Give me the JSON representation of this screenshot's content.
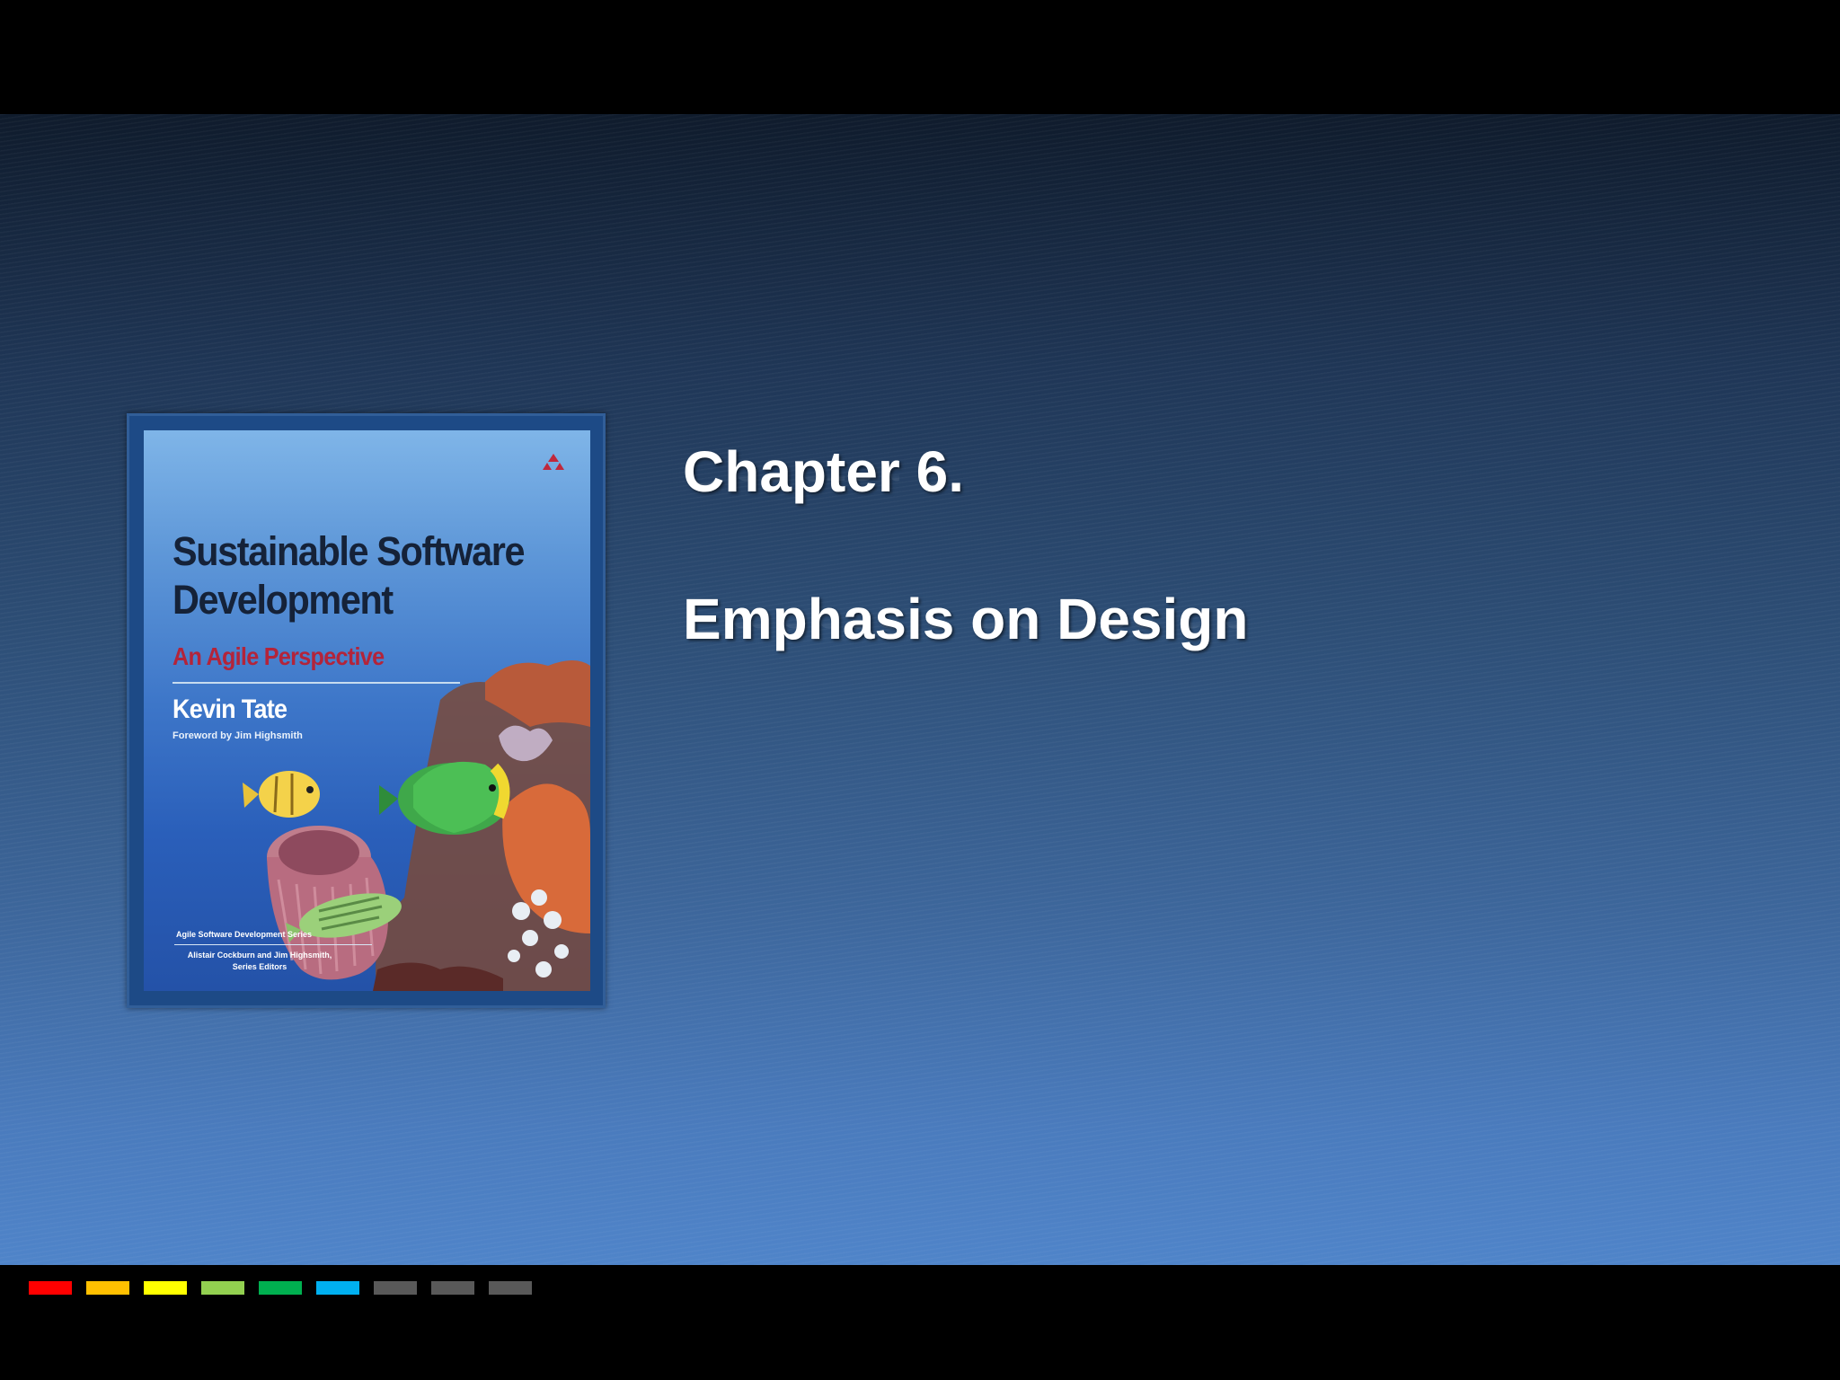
{
  "slide": {
    "heading_line1": "Chapter 6.",
    "heading_line2": "Emphasis on Design"
  },
  "book_cover": {
    "title": "Sustainable Software Development",
    "subtitle": "An Agile Perspective",
    "author": "Kevin Tate",
    "foreword": "Foreword by Jim Highsmith",
    "series": "Agile Software Development Series",
    "series_editors": "Alistair Cockburn and Jim Highsmith, Series Editors",
    "publisher_logo": "publisher-logo-icon"
  },
  "footer": {
    "swatches": [
      "#ff0000",
      "#ffc000",
      "#ffff00",
      "#92d050",
      "#00b050",
      "#00b0f0",
      "#595959",
      "#595959",
      "#595959"
    ]
  },
  "colors": {
    "background_top": "#0f1b2c",
    "background_bottom": "#4f84c9",
    "heading_text": "#ffffff",
    "cover_subtitle": "#b3243a"
  }
}
